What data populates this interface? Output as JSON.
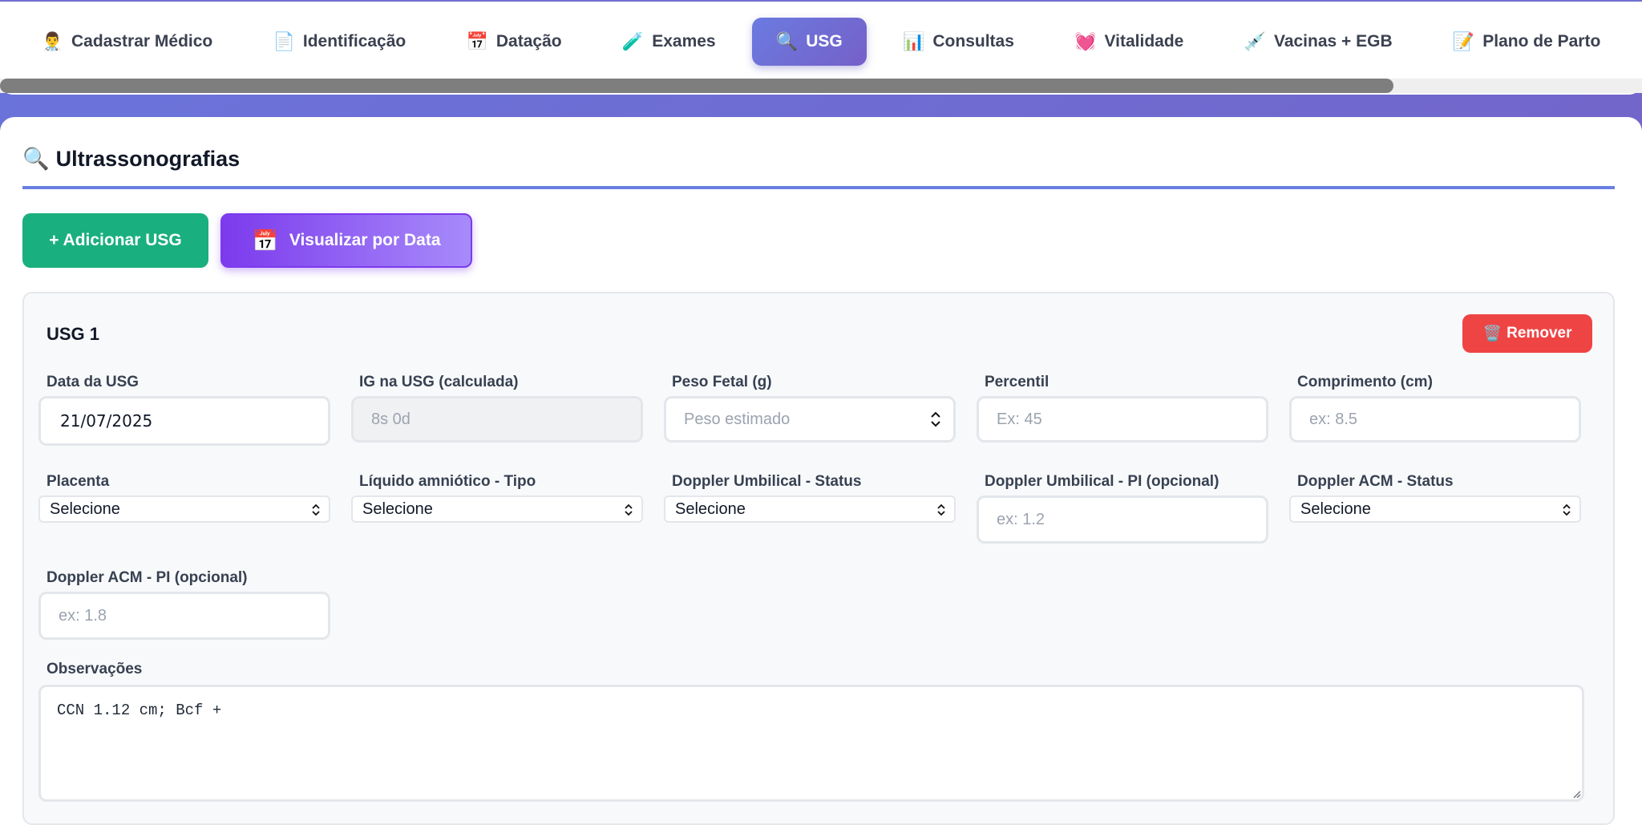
{
  "tabs": [
    {
      "icon": "👨‍⚕️",
      "label": "Cadastrar Médico"
    },
    {
      "icon": "📄",
      "label": "Identificação"
    },
    {
      "icon": "📅",
      "label": "Datação"
    },
    {
      "icon": "🧪",
      "label": "Exames"
    },
    {
      "icon": "🔍",
      "label": "USG",
      "active": true
    },
    {
      "icon": "📊",
      "label": "Consultas"
    },
    {
      "icon": "💓",
      "label": "Vitalidade"
    },
    {
      "icon": "💉",
      "label": "Vacinas + EGB"
    },
    {
      "icon": "📝",
      "label": "Plano de Parto"
    }
  ],
  "section": {
    "icon": "🔍",
    "title": "Ultrassonografias"
  },
  "actions": {
    "add_label": "+ Adicionar USG",
    "view_icon": "📅",
    "view_label": "Visualizar por Data"
  },
  "usg": {
    "title": "USG 1",
    "remove_icon": "🗑️",
    "remove_label": "Remover",
    "fields": {
      "data": {
        "label": "Data da USG",
        "value": "21/07/2025"
      },
      "ig": {
        "label": "IG na USG (calculada)",
        "placeholder": "8s 0d"
      },
      "peso": {
        "label": "Peso Fetal (g)",
        "placeholder": "Peso estimado"
      },
      "percentil": {
        "label": "Percentil",
        "placeholder": "Ex: 45"
      },
      "comprimento": {
        "label": "Comprimento (cm)",
        "placeholder": "ex: 8.5"
      },
      "placenta": {
        "label": "Placenta",
        "value": "Selecione"
      },
      "liquido": {
        "label": "Líquido amniótico - Tipo",
        "value": "Selecione"
      },
      "doppler_umb_status": {
        "label": "Doppler Umbilical - Status",
        "value": "Selecione"
      },
      "doppler_umb_pi": {
        "label": "Doppler Umbilical - PI (opcional)",
        "placeholder": "ex: 1.2"
      },
      "doppler_acm_status": {
        "label": "Doppler ACM - Status",
        "value": "Selecione"
      },
      "doppler_acm_pi": {
        "label": "Doppler ACM - PI (opcional)",
        "placeholder": "ex: 1.8"
      },
      "observacoes": {
        "label": "Observações",
        "value": "CCN 1.12 cm; Bcf +"
      }
    }
  },
  "colors": {
    "accent": "#6a7fe2",
    "add_button": "#1aaf7e",
    "view_button": "#7c3aed",
    "remove_button": "#ef4444"
  }
}
